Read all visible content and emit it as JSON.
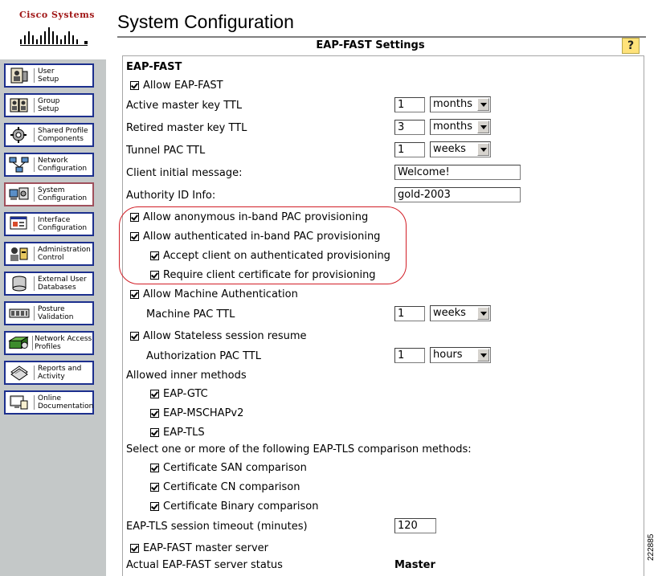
{
  "brand": "Cisco Systems",
  "page_title": "System Configuration",
  "section_title": "EAP-FAST Settings",
  "help_label": "?",
  "figure_id": "222885",
  "sidebar": {
    "items": [
      {
        "label": "User\nSetup",
        "icon": "user-setup-icon"
      },
      {
        "label": "Group\nSetup",
        "icon": "group-setup-icon"
      },
      {
        "label": "Shared Profile\nComponents",
        "icon": "shared-profile-icon"
      },
      {
        "label": "Network\nConfiguration",
        "icon": "network-config-icon"
      },
      {
        "label": "System\nConfiguration",
        "icon": "system-config-icon",
        "active": true
      },
      {
        "label": "Interface\nConfiguration",
        "icon": "interface-config-icon"
      },
      {
        "label": "Administration\nControl",
        "icon": "admin-control-icon"
      },
      {
        "label": "External User\nDatabases",
        "icon": "external-db-icon"
      },
      {
        "label": "Posture\nValidation",
        "icon": "posture-icon"
      },
      {
        "label": "Network Access\nProfiles",
        "icon": "nap-icon"
      },
      {
        "label": "Reports and\nActivity",
        "icon": "reports-icon"
      },
      {
        "label": "Online\nDocumentation",
        "icon": "docs-icon"
      }
    ]
  },
  "form": {
    "heading": "EAP-FAST",
    "allow_eap_fast": {
      "label": "Allow EAP-FAST",
      "checked": true
    },
    "active_master_key_ttl": {
      "label": "Active master key TTL",
      "value": "1",
      "unit": "months"
    },
    "retired_master_key_ttl": {
      "label": "Retired master key TTL",
      "value": "3",
      "unit": "months"
    },
    "tunnel_pac_ttl": {
      "label": "Tunnel PAC TTL",
      "value": "1",
      "unit": "weeks"
    },
    "client_initial_message": {
      "label": "Client initial message:",
      "value": "Welcome!"
    },
    "authority_id_info": {
      "label": "Authority ID Info:",
      "value": "gold-2003"
    },
    "allow_anonymous": {
      "label": "Allow anonymous in-band PAC provisioning",
      "checked": true
    },
    "allow_authenticated": {
      "label": "Allow authenticated in-band PAC provisioning",
      "checked": true
    },
    "accept_client": {
      "label": "Accept client on authenticated provisioning",
      "checked": true
    },
    "require_client_cert": {
      "label": "Require client certificate for provisioning",
      "checked": true
    },
    "allow_machine_auth": {
      "label": "Allow Machine Authentication",
      "checked": true
    },
    "machine_pac_ttl": {
      "label": "Machine PAC TTL",
      "value": "1",
      "unit": "weeks"
    },
    "allow_stateless": {
      "label": "Allow Stateless session resume",
      "checked": true
    },
    "authorization_pac_ttl": {
      "label": "Authorization PAC TTL",
      "value": "1",
      "unit": "hours"
    },
    "allowed_inner_methods": "Allowed inner methods",
    "eap_gtc": {
      "label": "EAP-GTC",
      "checked": true
    },
    "eap_mschapv2": {
      "label": "EAP-MSCHAPv2",
      "checked": true
    },
    "eap_tls": {
      "label": "EAP-TLS",
      "checked": true
    },
    "tls_comparison_label": "Select one or more of the following EAP-TLS comparison methods:",
    "cert_san": {
      "label": "Certificate SAN comparison",
      "checked": true
    },
    "cert_cn": {
      "label": "Certificate CN comparison",
      "checked": true
    },
    "cert_binary": {
      "label": "Certificate Binary comparison",
      "checked": true
    },
    "tls_session_timeout": {
      "label": "EAP-TLS session timeout (minutes)",
      "value": "120"
    },
    "master_server": {
      "label": "EAP-FAST master server",
      "checked": true
    },
    "server_status": {
      "label": "Actual EAP-FAST server status",
      "value": "Master"
    }
  },
  "colors": {
    "brand_red": "#a01616",
    "nav_border": "#1c2f8e",
    "sidebar_bg": "#c4c8c8",
    "highlight": "#d21e26",
    "help_bg": "#ffe27a"
  }
}
